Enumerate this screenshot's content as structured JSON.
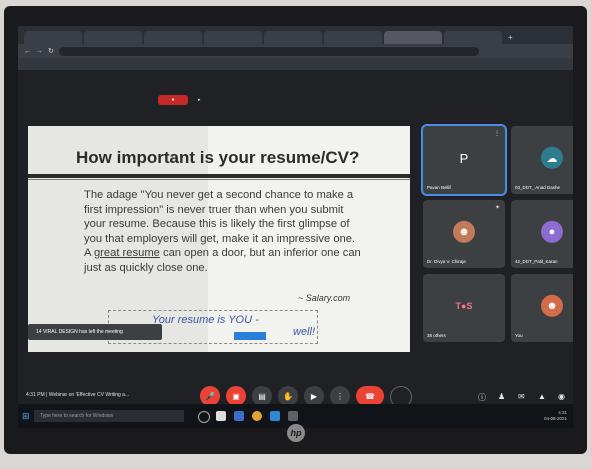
{
  "slide": {
    "title": "How important is your resume/CV?",
    "body_1": "The adage \"You never get a second chance to make a first impression\" is never truer than when you submit your resume. Because this is likely the first glimpse of you that employers will get, make it an impressive one. A ",
    "link_1": "great resume",
    "body_2": " can open a door, but an inferior one can just as quickly close one.",
    "source": "~ Salary.com",
    "quote_part1": "Your resume is YOU -",
    "quote_part2": "well!"
  },
  "toast": {
    "text": "14 VIRAL DESIGN has left the meeting"
  },
  "tiles": [
    {
      "name": "Pavan Bellif",
      "initial": "P",
      "avatar_color": "#3c4043"
    },
    {
      "name": "03_DDT_ Anad Dashe",
      "initial": "",
      "avatar_color": "#2e7d8f"
    },
    {
      "name": "Dr. Divya V. Chiraje",
      "initial": "",
      "avatar_color": "#c27a5a"
    },
    {
      "name": "42_DDT_Patil_Karan",
      "initial": "",
      "avatar_color": "#8e6bd1"
    },
    {
      "name": "38 others",
      "initial": "",
      "avatar_color": "#c2185b"
    },
    {
      "name": "You",
      "initial": "",
      "avatar_color": "#d46b4a"
    }
  ],
  "controls": {
    "time": "4:31 PM | Webinar on 'Effective CV Writing a..."
  },
  "taskbar": {
    "search_placeholder": "Type here to search for Windows",
    "clock": "4:31",
    "date": "04-08-2021"
  },
  "monitor": {
    "logo": "hp"
  }
}
